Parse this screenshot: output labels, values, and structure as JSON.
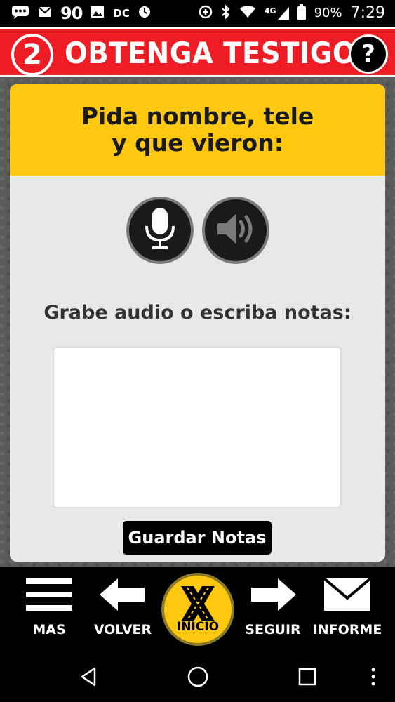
{
  "status_bar": {
    "notification_count": "90",
    "dc_label": "DC",
    "network_label": "4G",
    "battery_percent": "90%",
    "time": "7:29"
  },
  "header": {
    "step_number": "2",
    "title": "OBTENGA TESTIGOS",
    "help_label": "?",
    "color": "#ee1c24"
  },
  "card": {
    "banner_line1": "Pida nombre, tele",
    "banner_line2": "y que vieron:",
    "banner_color": "#fdc80f",
    "notes_label": "Grabe audio o escriba notas:",
    "notes_value": "",
    "save_label": "Guardar Notas"
  },
  "bottom_nav": {
    "mas_label": "MAS",
    "volver_label": "VOLVER",
    "inicio_label": "INICIO",
    "seguir_label": "SEGUIR",
    "informe_label": "INFORME"
  },
  "icons": {
    "mic": "microphone-icon",
    "speaker": "speaker-icon",
    "menu": "hamburger-menu-icon",
    "back": "arrow-left-icon",
    "forward": "arrow-right-icon",
    "mail": "envelope-icon"
  }
}
